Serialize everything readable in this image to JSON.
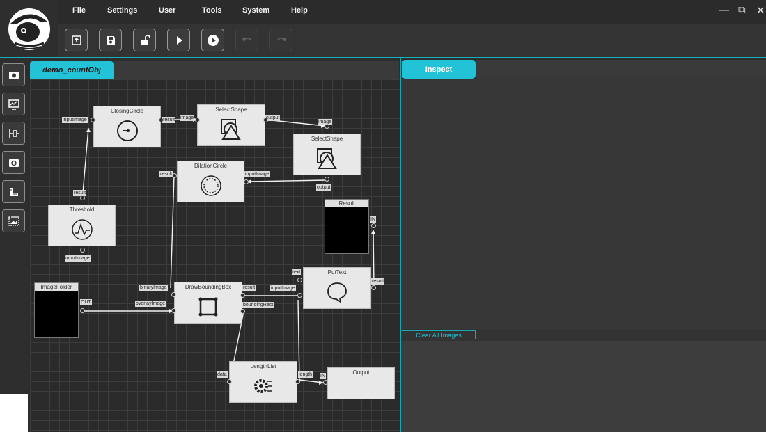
{
  "menu": [
    "File",
    "Settings",
    "User",
    "Tools",
    "System",
    "Help"
  ],
  "window_controls": [
    "minimize-icon",
    "restore-icon",
    "close-icon"
  ],
  "toolbar": [
    "export-icon",
    "save-icon",
    "unlock-icon",
    "play-icon",
    "run-once-icon",
    "undo-icon",
    "redo-icon"
  ],
  "left_tools": [
    "camera-icon",
    "monitor-icon",
    "plug-icon",
    "rotate-icon",
    "ruler-icon",
    "gallery-icon"
  ],
  "editor": {
    "tab": "demo_countObj"
  },
  "inspect": {
    "tab": "Inspect",
    "clear_button": "Clear All Images"
  },
  "nodes": {
    "closing_circle": {
      "title": "ClosingCircle",
      "in": "inputImage",
      "out": "result"
    },
    "select_shape_1": {
      "title": "SelectShape",
      "in": "image",
      "out": "output"
    },
    "select_shape_2": {
      "title": "SelectShape",
      "in": "image",
      "out": "output"
    },
    "dilation_circle": {
      "title": "DilationCircle",
      "in": "inputImage",
      "out": "result"
    },
    "threshold": {
      "title": "Threshold",
      "in": "inputImage",
      "out": "result"
    },
    "result": {
      "title": "Result",
      "in": "IN"
    },
    "image_folder": {
      "title": "ImageFolder",
      "out": "OUT"
    },
    "draw_bounding_box": {
      "title": "DrawBoundingBox",
      "in1": "binaryImage",
      "in2": "overlayImage",
      "out1": "result",
      "out2": "boundingRect"
    },
    "put_text": {
      "title": "PutText",
      "in1": "text",
      "in2": "inputImage",
      "out": "result"
    },
    "length_list": {
      "title": "LengthList",
      "in": "data",
      "out": "length"
    },
    "output": {
      "title": "Output",
      "in": "IN"
    }
  },
  "colors": {
    "accent": "#22c3d6",
    "node_bg": "#e8e8e8",
    "canvas_bg": "#2a2a2a"
  }
}
